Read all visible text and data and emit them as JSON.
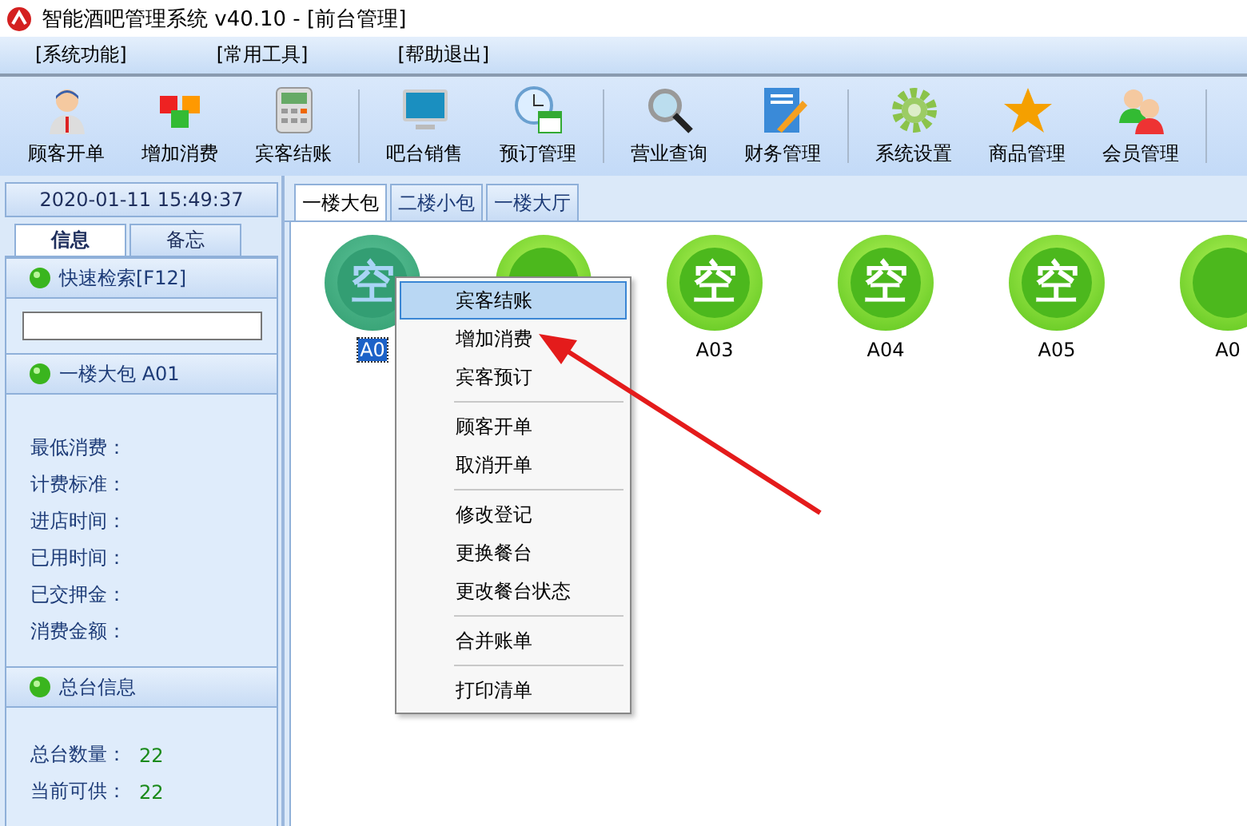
{
  "window": {
    "title": "智能酒吧管理系统 v40.10 - [前台管理]"
  },
  "menu": [
    "[系统功能]",
    "[常用工具]",
    "[帮助退出]"
  ],
  "toolbar": [
    [
      {
        "label": "顾客开单"
      },
      {
        "label": "增加消费"
      },
      {
        "label": "宾客结账"
      }
    ],
    [
      {
        "label": "吧台销售"
      },
      {
        "label": "预订管理"
      }
    ],
    [
      {
        "label": "营业查询"
      },
      {
        "label": "财务管理"
      }
    ],
    [
      {
        "label": "系统设置"
      },
      {
        "label": "商品管理"
      },
      {
        "label": "会员管理"
      }
    ]
  ],
  "sidebar": {
    "datetime": "2020-01-11 15:49:37",
    "tabs": [
      {
        "label": "信息",
        "selected": true
      },
      {
        "label": "备忘",
        "selected": false
      }
    ],
    "search": {
      "title": "快速检索[F12]"
    },
    "room_info": {
      "title": "一楼大包 A01",
      "fields": [
        "最低消费：",
        "计费标准：",
        "进店时间：",
        "已用时间：",
        "已交押金：",
        "消费金额："
      ]
    },
    "summary": {
      "title": "总台信息",
      "rows": [
        {
          "label": "总台数量：",
          "value": "22"
        },
        {
          "label": "当前可供：",
          "value": "22"
        }
      ]
    }
  },
  "tabs": [
    {
      "label": "一楼大包",
      "selected": true
    },
    {
      "label": "二楼小包",
      "selected": false
    },
    {
      "label": "一楼大厅",
      "selected": false
    }
  ],
  "rooms": [
    {
      "status": "空",
      "label": "A0",
      "selected": true
    },
    {
      "selected": false
    },
    {
      "status": "空",
      "label": "A03",
      "selected": false
    },
    {
      "status": "空",
      "label": "A04",
      "selected": false
    },
    {
      "status": "空",
      "label": "A05",
      "selected": false
    },
    {
      "label": "A0",
      "selected": false
    }
  ],
  "context_menu": [
    [
      {
        "label": "宾客结账",
        "selected": true
      },
      {
        "label": "增加消费",
        "selected": false
      },
      {
        "label": "宾客预订",
        "selected": false
      }
    ],
    [
      {
        "label": "顾客开单",
        "selected": false
      },
      {
        "label": "取消开单",
        "selected": false
      }
    ],
    [
      {
        "label": "修改登记",
        "selected": false
      },
      {
        "label": "更换餐台",
        "selected": false
      },
      {
        "label": "更改餐台状态",
        "selected": false
      }
    ],
    [
      {
        "label": "合并账单",
        "selected": false
      }
    ],
    [
      {
        "label": "打印清单",
        "selected": false
      }
    ]
  ]
}
